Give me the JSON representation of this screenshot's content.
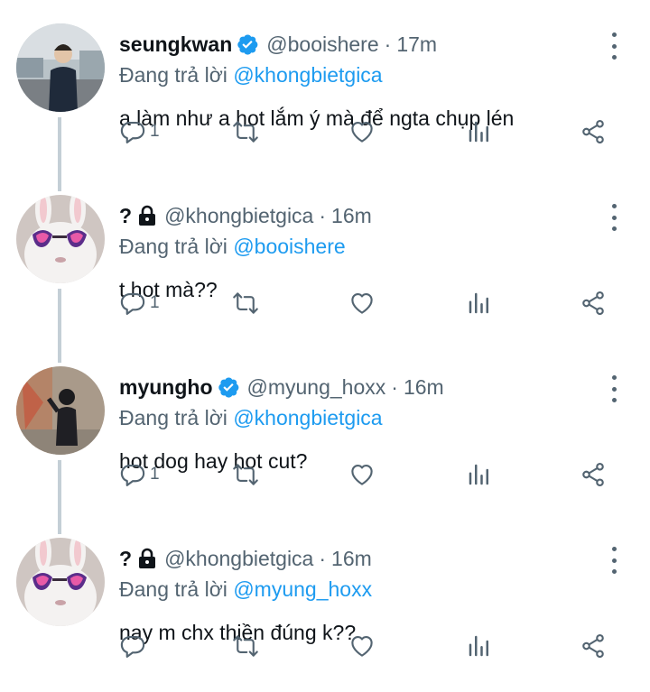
{
  "tweets": [
    {
      "name": "seungkwan",
      "verified": true,
      "handle": "@booishere",
      "time": "17m",
      "reply_prefix": "Đang trả lời",
      "reply_to": "@khongbietgica",
      "text": "a làm như a hot lắm ý mà để ngta chụp lén",
      "reply_count": "1",
      "avatar": "photo-icon"
    },
    {
      "name": "?",
      "locked": true,
      "handle": "@khongbietgica",
      "time": "16m",
      "reply_prefix": "Đang trả lời",
      "reply_to": "@booishere",
      "text": "t hot mà??",
      "reply_count": "1",
      "avatar": "rabbit-with-sunglasses-icon"
    },
    {
      "name": "myungho",
      "verified": true,
      "handle": "@myung_hoxx",
      "time": "16m",
      "reply_prefix": "Đang trả lời",
      "reply_to": "@khongbietgica",
      "text": "hot dog hay hot cut?",
      "reply_count": "1",
      "avatar": "photo-icon"
    },
    {
      "name": "?",
      "locked": true,
      "handle": "@khongbietgica",
      "time": "16m",
      "reply_prefix": "Đang trả lời",
      "reply_to": "@myung_hoxx",
      "text": "nay m chx thiền đúng k??",
      "reply_count": "",
      "avatar": "rabbit-with-sunglasses-icon"
    }
  ],
  "separator": "·",
  "colors": {
    "accent": "#1d9bf0",
    "secondary_text": "#536471",
    "thread_line": "#c4cfd6"
  }
}
